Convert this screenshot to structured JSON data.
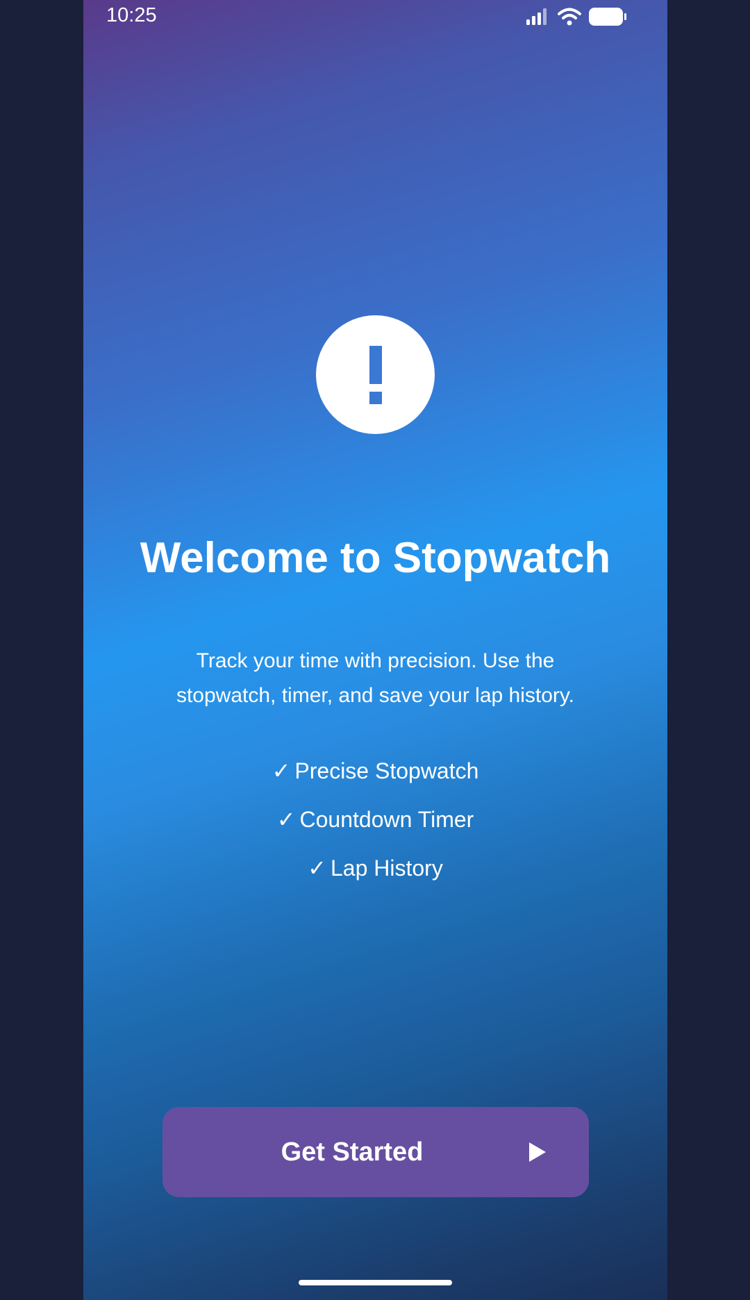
{
  "status_bar": {
    "time": "10:25",
    "icons": [
      "signal-icon",
      "wifi-icon",
      "battery-icon"
    ]
  },
  "hero_icon": "alert-icon",
  "title": "Welcome to Stopwatch",
  "description": "Track your time with precision. Use the stopwatch, timer, and save your lap history.",
  "features": [
    {
      "check": "✓",
      "label": "Precise Stopwatch"
    },
    {
      "check": "✓",
      "label": "Countdown Timer"
    },
    {
      "check": "✓",
      "label": "Lap History"
    }
  ],
  "button": {
    "label": "Get Started",
    "icon": "play-icon",
    "color": "#664fa0"
  },
  "colors": {
    "gradient_top": "#5a3a8a",
    "gradient_mid": "#2596ee",
    "gradient_bottom": "#1a2f58",
    "icon_accent": "#3a78d4"
  }
}
